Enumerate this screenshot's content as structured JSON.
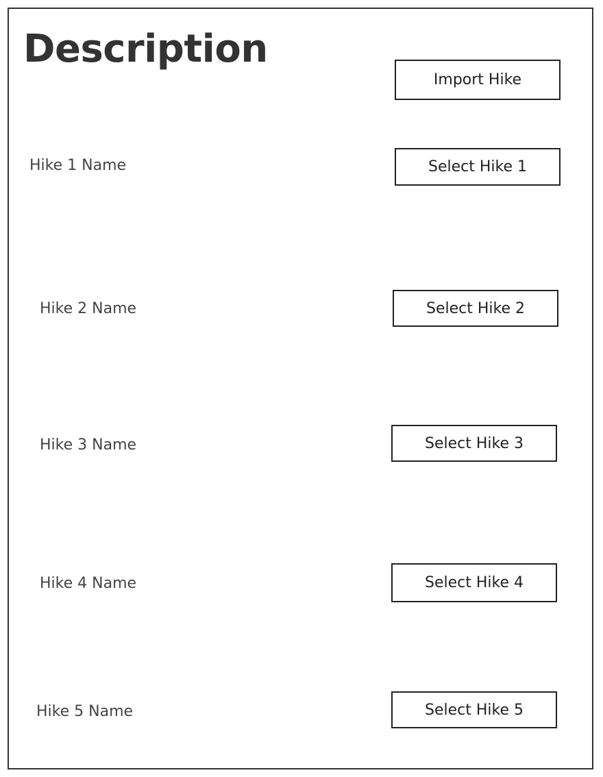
{
  "page": {
    "title": "Description",
    "import_button": "Import Hike"
  },
  "hikes": [
    {
      "name": "Hike 1 Name",
      "button": "Select Hike 1"
    },
    {
      "name": "Hike 2 Name",
      "button": "Select Hike 2"
    },
    {
      "name": "Hike 3 Name",
      "button": "Select Hike 3"
    },
    {
      "name": "Hike 4 Name",
      "button": "Select Hike 4"
    },
    {
      "name": "Hike 5 Name",
      "button": "Select Hike 5"
    }
  ]
}
